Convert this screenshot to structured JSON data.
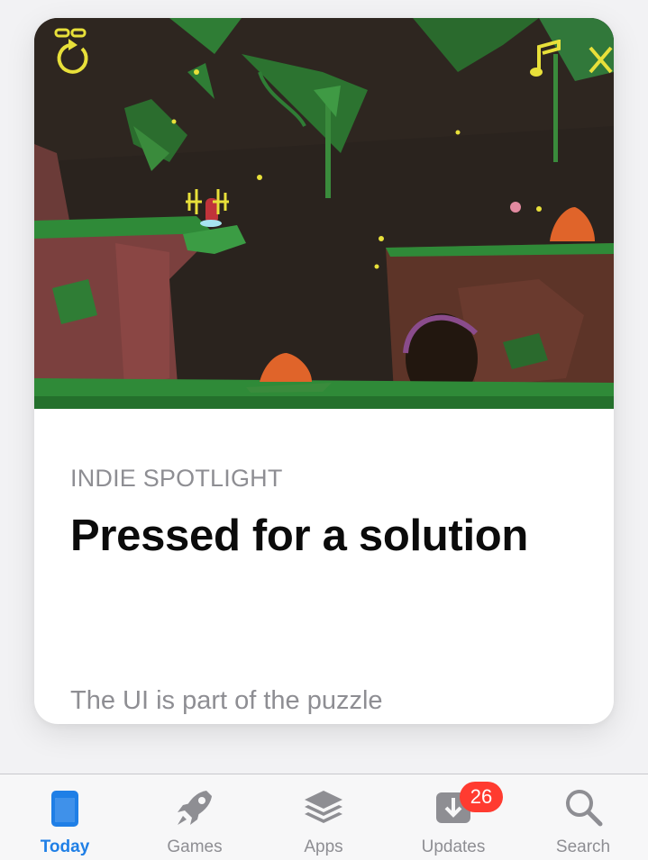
{
  "card": {
    "eyebrow": "INDIE SPOTLIGHT",
    "title": "Pressed for a solution",
    "subtitle": "The UI is part of the puzzle",
    "game_hud": {
      "restart_icon": "restart-icon",
      "music_icon": "music-note-icon",
      "close_icon": "close-x-icon",
      "hud_color": "#e8e03a"
    }
  },
  "tabbar": {
    "active_color": "#1f7fe6",
    "inactive_color": "#8e8e93",
    "tabs": [
      {
        "label": "Today",
        "icon": "today-card-icon",
        "active": true
      },
      {
        "label": "Games",
        "icon": "rocket-icon",
        "active": false
      },
      {
        "label": "Apps",
        "icon": "layers-stack-icon",
        "active": false
      },
      {
        "label": "Updates",
        "icon": "download-tray-icon",
        "active": false,
        "badge": "26"
      },
      {
        "label": "Search",
        "icon": "magnifier-icon",
        "active": false
      }
    ]
  }
}
